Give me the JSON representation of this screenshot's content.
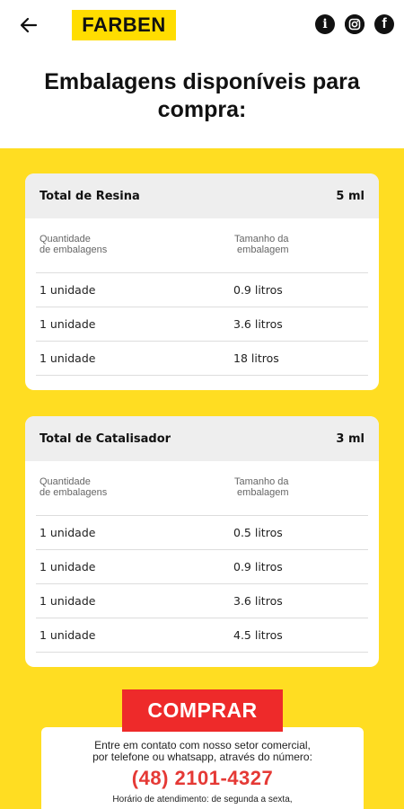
{
  "header": {
    "logo_text": "FARBEN",
    "back_icon": "arrow-left-icon",
    "social": [
      {
        "icon": "info-icon",
        "glyph": "i"
      },
      {
        "icon": "instagram-icon",
        "glyph": "◎"
      },
      {
        "icon": "facebook-icon",
        "glyph": "f"
      }
    ]
  },
  "page_title": "Embalagens disponíveis para compra:",
  "cards": [
    {
      "name": "Total de Resina",
      "amount": "5 ml",
      "col1": "Quantidade\nde embalagens",
      "col2": "Tamanho da\n embalagem",
      "rows": [
        {
          "qty": "1 unidade",
          "size": "0.9 litros"
        },
        {
          "qty": "1 unidade",
          "size": "3.6 litros"
        },
        {
          "qty": "1 unidade",
          "size": "18 litros"
        }
      ]
    },
    {
      "name": "Total de Catalisador",
      "amount": "3 ml",
      "col1": "Quantidade\nde embalagens",
      "col2": "Tamanho da\n embalagem",
      "rows": [
        {
          "qty": "1 unidade",
          "size": "0.5 litros"
        },
        {
          "qty": "1 unidade",
          "size": "0.9 litros"
        },
        {
          "qty": "1 unidade",
          "size": "3.6 litros"
        },
        {
          "qty": "1 unidade",
          "size": "4.5 litros"
        }
      ]
    }
  ],
  "buy_label": "COMPRAR",
  "contact": {
    "line1": "Entre em contato com nosso setor comercial,",
    "line2": "por telefone ou whatsapp, através do número:",
    "phone": "(48) 2101-4327",
    "hours": "Horário de atendimento: de segunda a sexta,"
  },
  "colors": {
    "brand_yellow": "#FFDD22",
    "buy_red": "#EE2A2A",
    "phone_red": "#E53935"
  }
}
